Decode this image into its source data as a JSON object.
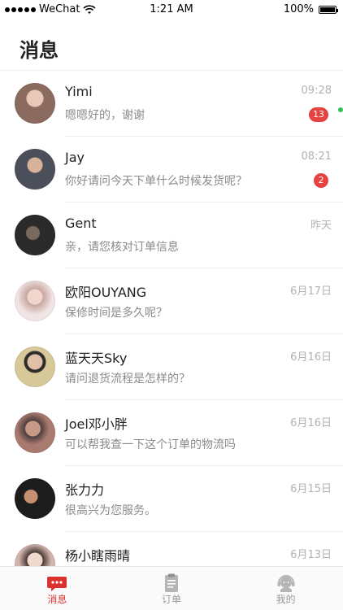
{
  "status_bar": {
    "carrier": "WeChat",
    "time": "1:21 AM",
    "battery": "100%"
  },
  "header": {
    "title": "消息"
  },
  "conversations": [
    {
      "name": "Yimi",
      "time": "09:28",
      "preview": "嗯嗯好的，谢谢",
      "badge": "13",
      "avatar_color": "#8b6b60"
    },
    {
      "name": "Jay",
      "time": "08:21",
      "preview": "你好请问今天下单什么时候发货呢？",
      "badge": "2",
      "avatar_color": "#4b4f59"
    },
    {
      "name": "Gent",
      "time": "昨天",
      "preview": "亲，请您核对订单信息",
      "avatar_color": "#2a2a2a"
    },
    {
      "name": "欧阳OUYANG",
      "time": "6月17日",
      "preview": "保修时间是多久呢？",
      "avatar_color": "#c8a6a0"
    },
    {
      "name": "蓝天天Sky",
      "time": "6月16日",
      "preview": "请问退货流程是怎样的？",
      "avatar_color": "#d7c89a"
    },
    {
      "name": "Joel邓小胖",
      "time": "6月16日",
      "preview": "可以帮我查一下这个订单的物流吗",
      "avatar_color": "#4c3f3f"
    },
    {
      "name": "张力力",
      "time": "6月15日",
      "preview": "很高兴为您服务。",
      "avatar_color": "#1d1d1d"
    },
    {
      "name": "杨小瞎雨晴",
      "time": "6月13日",
      "preview": "",
      "avatar_color": "#d0b4ad"
    }
  ],
  "tabbar": [
    {
      "label": "消息",
      "icon": "chat-bubble-icon",
      "active": true
    },
    {
      "label": "订单",
      "icon": "clipboard-icon",
      "active": false
    },
    {
      "label": "我的",
      "icon": "headset-user-icon",
      "active": false
    }
  ],
  "colors": {
    "accent": "#d9322f",
    "badge": "#e64340",
    "online": "#30c24f"
  }
}
